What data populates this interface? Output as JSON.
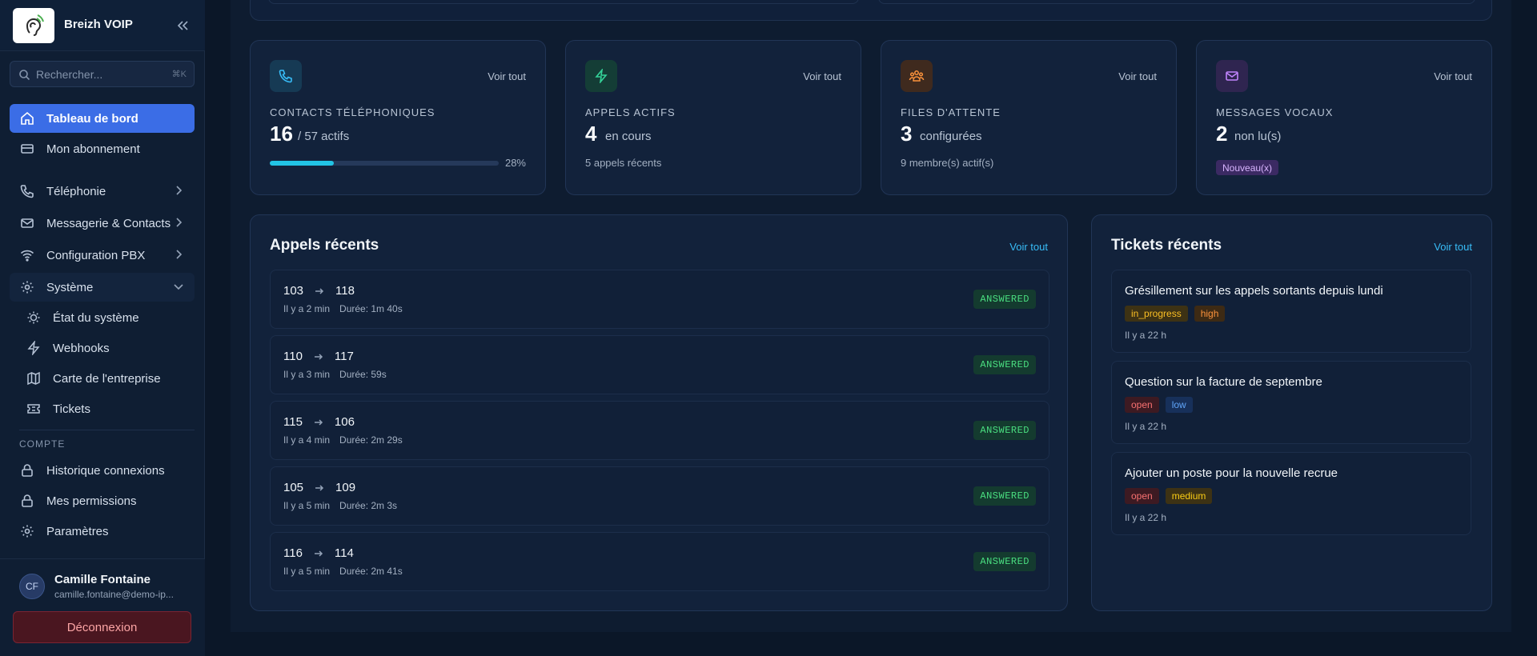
{
  "app": {
    "name": "Breizh VOIP"
  },
  "search": {
    "placeholder": "Rechercher...",
    "shortcut": "⌘K"
  },
  "nav": {
    "dashboard": "Tableau de bord",
    "subscription": "Mon abonnement",
    "telephony": "Téléphonie",
    "messaging": "Messagerie & Contacts",
    "pbx": "Configuration PBX",
    "system": "Système",
    "system_items": [
      "État du système",
      "Webhooks",
      "Carte de l'entreprise",
      "Tickets"
    ],
    "account_section": "COMPTE",
    "account_items": [
      "Historique connexions",
      "Mes permissions",
      "Paramètres"
    ]
  },
  "user": {
    "initials": "CF",
    "name": "Camille Fontaine",
    "email": "camille.fontaine@demo-ip..."
  },
  "logout_label": "Déconnexion",
  "view_all": "Voir tout",
  "stats": {
    "contacts": {
      "label": "CONTACTS TÉLÉPHONIQUES",
      "value": "16",
      "unit": "/ 57 actifs",
      "progress_pct": 28,
      "progress_label": "28%"
    },
    "active_calls": {
      "label": "APPELS ACTIFS",
      "value": "4",
      "unit": "en cours",
      "sub": "5 appels récents"
    },
    "queues": {
      "label": "FILES D'ATTENTE",
      "value": "3",
      "unit": "configurées",
      "sub": "9 membre(s) actif(s)"
    },
    "voicemail": {
      "label": "MESSAGES VOCAUX",
      "value": "2",
      "unit": "non lu(s)",
      "badge": "Nouveau(x)"
    }
  },
  "recent_calls": {
    "title": "Appels récents",
    "link": "Voir tout",
    "rows": [
      {
        "from": "103",
        "to": "118",
        "ago": "Il y a 2 min",
        "duration": "Durée: 1m 40s",
        "status": "ANSWERED"
      },
      {
        "from": "110",
        "to": "117",
        "ago": "Il y a 3 min",
        "duration": "Durée: 59s",
        "status": "ANSWERED"
      },
      {
        "from": "115",
        "to": "106",
        "ago": "Il y a 4 min",
        "duration": "Durée: 2m 29s",
        "status": "ANSWERED"
      },
      {
        "from": "105",
        "to": "109",
        "ago": "Il y a 5 min",
        "duration": "Durée: 2m 3s",
        "status": "ANSWERED"
      },
      {
        "from": "116",
        "to": "114",
        "ago": "Il y a 5 min",
        "duration": "Durée: 2m 41s",
        "status": "ANSWERED"
      }
    ]
  },
  "recent_tickets": {
    "title": "Tickets récents",
    "link": "Voir tout",
    "rows": [
      {
        "title": "Grésillement sur les appels sortants depuis lundi",
        "status": "in_progress",
        "priority": "high",
        "ago": "Il y a 22 h"
      },
      {
        "title": "Question sur la facture de septembre",
        "status": "open",
        "priority": "low",
        "ago": "Il y a 22 h"
      },
      {
        "title": "Ajouter un poste pour la nouvelle recrue",
        "status": "open",
        "priority": "medium",
        "ago": "Il y a 22 h"
      }
    ]
  },
  "colors": {
    "accent": "#3b6de6",
    "progress": "#22c4e5",
    "answered": "#4ade80",
    "link": "#38bdf8"
  },
  "icons": [
    "ear-logo-icon",
    "collapse-chevrons-icon",
    "search-icon",
    "home-icon",
    "card-icon",
    "phone-icon",
    "mail-icon",
    "wifi-icon",
    "gear-icon",
    "chevron-right-icon",
    "chevron-down-icon",
    "bulb-icon",
    "bolt-icon",
    "map-icon",
    "ticket-icon",
    "lock-icon",
    "arrow-right-icon",
    "users-icon"
  ]
}
